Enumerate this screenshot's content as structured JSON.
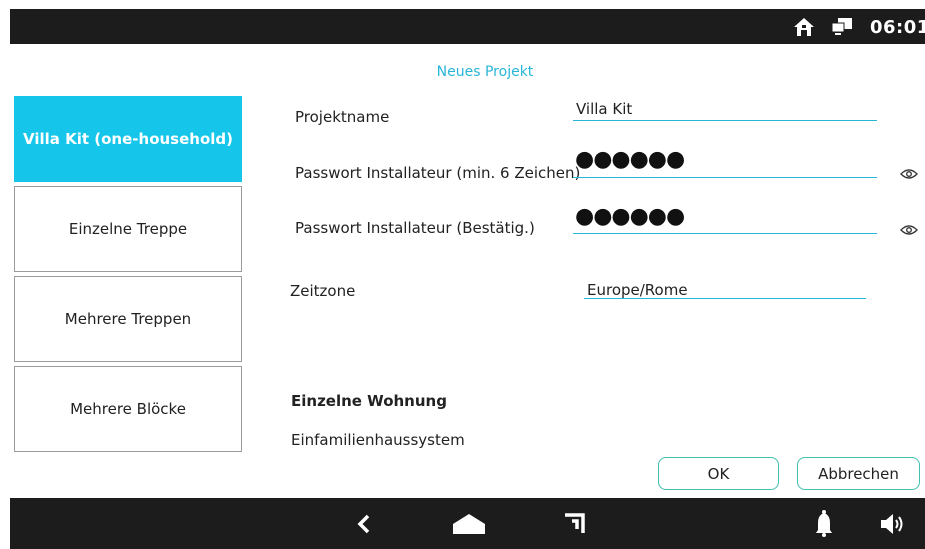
{
  "status": {
    "time": "06:01",
    "icons": [
      "home-icon",
      "network-icon"
    ]
  },
  "page": {
    "title": "Neues Projekt"
  },
  "sidebar": {
    "items": [
      {
        "label": "Villa Kit (one-household)",
        "active": true
      },
      {
        "label": "Einzelne Treppe",
        "active": false
      },
      {
        "label": "Mehrere Treppen",
        "active": false
      },
      {
        "label": "Mehrere Blöcke",
        "active": false
      }
    ]
  },
  "form": {
    "project_name": {
      "label": "Projektname",
      "value": "Villa Kit"
    },
    "password": {
      "label": "Passwort Installateur (min. 6 Zeichen)",
      "value": "●●●●●●"
    },
    "password_confirm": {
      "label": "Passwort Installateur (Bestätig.)",
      "value": "●●●●●●"
    },
    "timezone": {
      "label": "Zeitzone",
      "value": "Europe/Rome"
    }
  },
  "section": {
    "title": "Einzelne Wohnung",
    "text": "Einfamilienhaussystem"
  },
  "buttons": {
    "ok": "OK",
    "cancel": "Abbrechen"
  },
  "navbar": {
    "icons": [
      "back-icon",
      "home-icon",
      "recent-apps-icon",
      "bell-icon",
      "volume-icon"
    ]
  },
  "colors": {
    "accent": "#16c6ea",
    "title": "#29b6d8",
    "button_border": "#3fbfb0",
    "bars": "#1c1c1c"
  }
}
